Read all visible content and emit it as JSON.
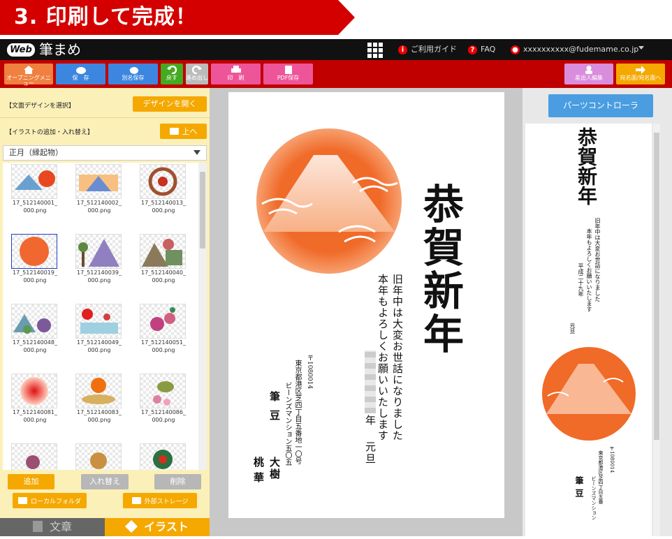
{
  "banner": {
    "text": "3. 印刷して完成！"
  },
  "topbar": {
    "logo_web": "Web",
    "logo_name": "筆まめ",
    "guide": "ご利用ガイド",
    "faq": "FAQ",
    "user_email": "xxxxxxxxxx@fudemame.co.jp"
  },
  "toolbar": {
    "opening": "オープニングメニュー",
    "save": "保　存",
    "save_as": "別名保存",
    "undo": "戻す",
    "redo": "進め出し",
    "print": "印　刷",
    "pdf": "PDF保存",
    "sender": "差出人編集",
    "address": "宛名面/宛名面へ"
  },
  "left": {
    "design_label": "【文面デザインを選択】",
    "open_design": "デザインを開く",
    "illust_label": "【イラストの追加・入れ替え】",
    "up": "上へ",
    "category": "正月（縁起物）",
    "thumbs": [
      {
        "l1": "17_512140001_",
        "l2": "000.png"
      },
      {
        "l1": "17_512140002_",
        "l2": "000.png"
      },
      {
        "l1": "17_512140013_",
        "l2": "000.png"
      },
      {
        "l1": "17_512140019_",
        "l2": "000.png"
      },
      {
        "l1": "17_512140039_",
        "l2": "000.png"
      },
      {
        "l1": "17_512140040_",
        "l2": "000.png"
      },
      {
        "l1": "17_512140048_",
        "l2": "000.png"
      },
      {
        "l1": "17_512140049_",
        "l2": "000.png"
      },
      {
        "l1": "17_512140051_",
        "l2": "000.png"
      },
      {
        "l1": "17_512140081_",
        "l2": "000.png"
      },
      {
        "l1": "17_512140083_",
        "l2": "000.png"
      },
      {
        "l1": "17_512140086_",
        "l2": "000.png"
      }
    ],
    "add": "追加",
    "replace": "入れ替え",
    "delete": "削除",
    "local_folder": "ローカルフォルダ",
    "external_storage": "外部ストレージ",
    "tab_text": "文章",
    "tab_illust": "イラスト"
  },
  "card": {
    "greeting": "恭賀新年",
    "line1": "旧年中は大変お世話になりました",
    "line2": "本年もよろしくお願いいたします",
    "date_year": "年",
    "date": "元旦",
    "postal": "〒1080014",
    "address1": "東京都港区芝四丁目五番地一〇号",
    "address2": "ビーンズマンション五〇五",
    "name1_a": "筆",
    "name1_b": "豆",
    "name2_a": "大樹",
    "name2_b": "桃",
    "name2_c": "華"
  },
  "right": {
    "parts_controller": "パーツコントローラ",
    "greeting": "恭賀新年",
    "line1": "旧年中は大変お世話になりました",
    "line2": "本年もよろしくお願いいたします",
    "line3": "平成二十九年",
    "line4": "元旦",
    "postal": "〒1080014",
    "address1": "東京都港区芝四丁目五番",
    "address2": "ビーンズマンション",
    "name": "筆豆"
  },
  "colors": {
    "brand_red": "#c00000",
    "accent_orange": "#f5a800",
    "blue": "#4a9de0",
    "pink": "#ee5599"
  }
}
